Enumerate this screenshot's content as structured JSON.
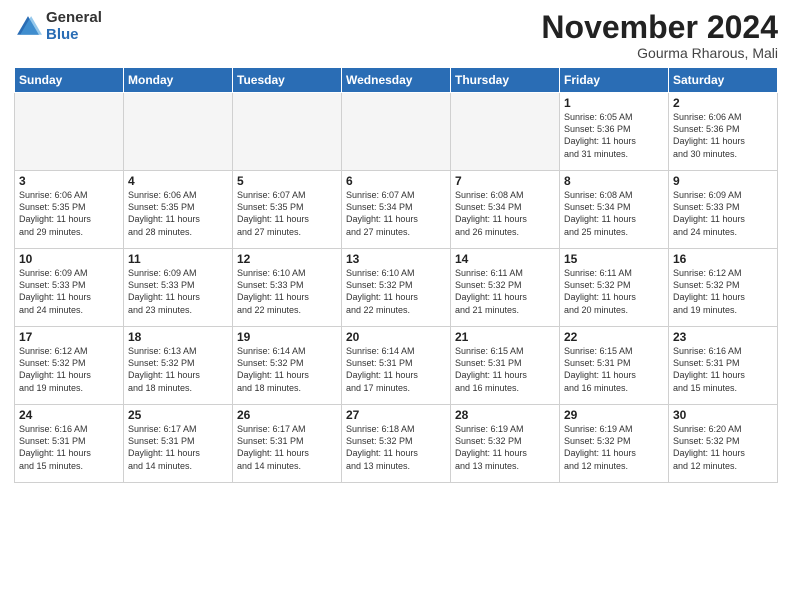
{
  "header": {
    "logo_general": "General",
    "logo_blue": "Blue",
    "month_title": "November 2024",
    "location": "Gourma Rharous, Mali"
  },
  "weekdays": [
    "Sunday",
    "Monday",
    "Tuesday",
    "Wednesday",
    "Thursday",
    "Friday",
    "Saturday"
  ],
  "weeks": [
    [
      {
        "day": "",
        "info": ""
      },
      {
        "day": "",
        "info": ""
      },
      {
        "day": "",
        "info": ""
      },
      {
        "day": "",
        "info": ""
      },
      {
        "day": "",
        "info": ""
      },
      {
        "day": "1",
        "info": "Sunrise: 6:05 AM\nSunset: 5:36 PM\nDaylight: 11 hours\nand 31 minutes."
      },
      {
        "day": "2",
        "info": "Sunrise: 6:06 AM\nSunset: 5:36 PM\nDaylight: 11 hours\nand 30 minutes."
      }
    ],
    [
      {
        "day": "3",
        "info": "Sunrise: 6:06 AM\nSunset: 5:35 PM\nDaylight: 11 hours\nand 29 minutes."
      },
      {
        "day": "4",
        "info": "Sunrise: 6:06 AM\nSunset: 5:35 PM\nDaylight: 11 hours\nand 28 minutes."
      },
      {
        "day": "5",
        "info": "Sunrise: 6:07 AM\nSunset: 5:35 PM\nDaylight: 11 hours\nand 27 minutes."
      },
      {
        "day": "6",
        "info": "Sunrise: 6:07 AM\nSunset: 5:34 PM\nDaylight: 11 hours\nand 27 minutes."
      },
      {
        "day": "7",
        "info": "Sunrise: 6:08 AM\nSunset: 5:34 PM\nDaylight: 11 hours\nand 26 minutes."
      },
      {
        "day": "8",
        "info": "Sunrise: 6:08 AM\nSunset: 5:34 PM\nDaylight: 11 hours\nand 25 minutes."
      },
      {
        "day": "9",
        "info": "Sunrise: 6:09 AM\nSunset: 5:33 PM\nDaylight: 11 hours\nand 24 minutes."
      }
    ],
    [
      {
        "day": "10",
        "info": "Sunrise: 6:09 AM\nSunset: 5:33 PM\nDaylight: 11 hours\nand 24 minutes."
      },
      {
        "day": "11",
        "info": "Sunrise: 6:09 AM\nSunset: 5:33 PM\nDaylight: 11 hours\nand 23 minutes."
      },
      {
        "day": "12",
        "info": "Sunrise: 6:10 AM\nSunset: 5:33 PM\nDaylight: 11 hours\nand 22 minutes."
      },
      {
        "day": "13",
        "info": "Sunrise: 6:10 AM\nSunset: 5:32 PM\nDaylight: 11 hours\nand 22 minutes."
      },
      {
        "day": "14",
        "info": "Sunrise: 6:11 AM\nSunset: 5:32 PM\nDaylight: 11 hours\nand 21 minutes."
      },
      {
        "day": "15",
        "info": "Sunrise: 6:11 AM\nSunset: 5:32 PM\nDaylight: 11 hours\nand 20 minutes."
      },
      {
        "day": "16",
        "info": "Sunrise: 6:12 AM\nSunset: 5:32 PM\nDaylight: 11 hours\nand 19 minutes."
      }
    ],
    [
      {
        "day": "17",
        "info": "Sunrise: 6:12 AM\nSunset: 5:32 PM\nDaylight: 11 hours\nand 19 minutes."
      },
      {
        "day": "18",
        "info": "Sunrise: 6:13 AM\nSunset: 5:32 PM\nDaylight: 11 hours\nand 18 minutes."
      },
      {
        "day": "19",
        "info": "Sunrise: 6:14 AM\nSunset: 5:32 PM\nDaylight: 11 hours\nand 18 minutes."
      },
      {
        "day": "20",
        "info": "Sunrise: 6:14 AM\nSunset: 5:31 PM\nDaylight: 11 hours\nand 17 minutes."
      },
      {
        "day": "21",
        "info": "Sunrise: 6:15 AM\nSunset: 5:31 PM\nDaylight: 11 hours\nand 16 minutes."
      },
      {
        "day": "22",
        "info": "Sunrise: 6:15 AM\nSunset: 5:31 PM\nDaylight: 11 hours\nand 16 minutes."
      },
      {
        "day": "23",
        "info": "Sunrise: 6:16 AM\nSunset: 5:31 PM\nDaylight: 11 hours\nand 15 minutes."
      }
    ],
    [
      {
        "day": "24",
        "info": "Sunrise: 6:16 AM\nSunset: 5:31 PM\nDaylight: 11 hours\nand 15 minutes."
      },
      {
        "day": "25",
        "info": "Sunrise: 6:17 AM\nSunset: 5:31 PM\nDaylight: 11 hours\nand 14 minutes."
      },
      {
        "day": "26",
        "info": "Sunrise: 6:17 AM\nSunset: 5:31 PM\nDaylight: 11 hours\nand 14 minutes."
      },
      {
        "day": "27",
        "info": "Sunrise: 6:18 AM\nSunset: 5:32 PM\nDaylight: 11 hours\nand 13 minutes."
      },
      {
        "day": "28",
        "info": "Sunrise: 6:19 AM\nSunset: 5:32 PM\nDaylight: 11 hours\nand 13 minutes."
      },
      {
        "day": "29",
        "info": "Sunrise: 6:19 AM\nSunset: 5:32 PM\nDaylight: 11 hours\nand 12 minutes."
      },
      {
        "day": "30",
        "info": "Sunrise: 6:20 AM\nSunset: 5:32 PM\nDaylight: 11 hours\nand 12 minutes."
      }
    ]
  ]
}
